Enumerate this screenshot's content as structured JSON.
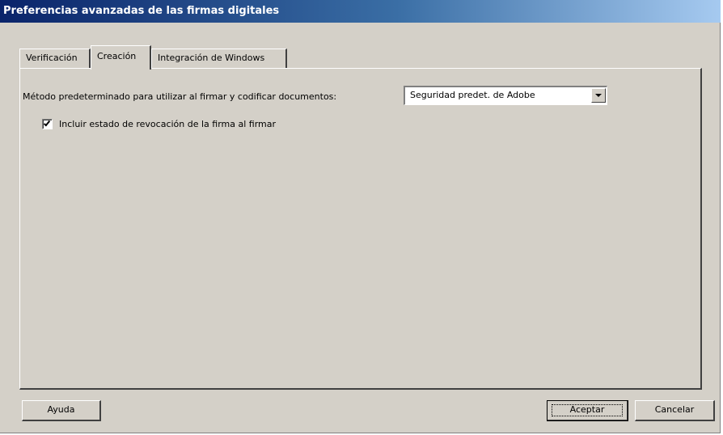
{
  "window": {
    "title": "Preferencias avanzadas de las firmas digitales"
  },
  "tabs": [
    {
      "label": "Verificación",
      "active": false
    },
    {
      "label": "Creación",
      "active": true
    },
    {
      "label": "Integración de Windows",
      "active": false
    }
  ],
  "creacion": {
    "method_label": "Método predeterminado para utilizar al firmar y codificar documentos:",
    "method_select": {
      "value": "Seguridad predet. de Adobe"
    },
    "revocation_checkbox": {
      "label": "Incluir estado de revocación de la firma al firmar",
      "checked": true
    }
  },
  "buttons": {
    "help": "Ayuda",
    "ok": "Aceptar",
    "cancel": "Cancelar"
  },
  "colors": {
    "face": "#d4d0c8",
    "title_gradient_start": "#0a246a",
    "title_gradient_end": "#a6caf0"
  },
  "icons": {
    "dropdown": "chevron-down-icon",
    "checkmark": "checkmark-icon"
  }
}
